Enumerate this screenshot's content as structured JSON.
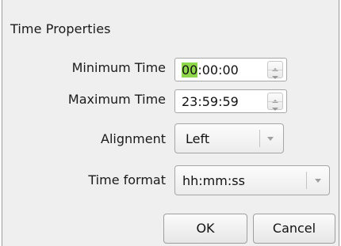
{
  "dialog": {
    "title": "Time  Properties"
  },
  "fields": {
    "min_time": {
      "label": "Minimum Time",
      "value_highlight": "00",
      "value_rest": ":00:00"
    },
    "max_time": {
      "label": "Maximum Time",
      "value": "23:59:59"
    },
    "alignment": {
      "label": "Alignment",
      "value": "Left"
    },
    "time_format": {
      "label": "Time format",
      "value": "hh:mm:ss"
    }
  },
  "buttons": {
    "ok": "OK",
    "cancel": "Cancel"
  },
  "colors": {
    "selection": "#8ed64a"
  },
  "icons": {
    "spin_up": "triangle-up-icon",
    "spin_down": "triangle-down-icon",
    "dropdown": "chevron-down-icon"
  }
}
